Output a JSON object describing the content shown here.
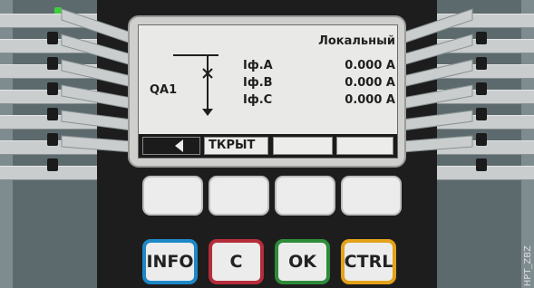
{
  "lcd": {
    "header": "Локальный",
    "device_label": "QA1",
    "measurements": [
      {
        "label": "Iф.A",
        "value": "0.000 A"
      },
      {
        "label": "Iф.B",
        "value": "0.000 A"
      },
      {
        "label": "Iф.C",
        "value": "0.000 A"
      }
    ],
    "softkeys": [
      {
        "icon": "arrow-left-icon",
        "label": ""
      },
      {
        "label": "ТКРЫТ"
      },
      {
        "label": ""
      },
      {
        "label": ""
      }
    ]
  },
  "buttons": {
    "blank_buttons": [
      "",
      "",
      "",
      ""
    ],
    "keys": [
      {
        "label": "INFO",
        "color": "#1e88c7"
      },
      {
        "label": "C",
        "color": "#b52d3a"
      },
      {
        "label": "OK",
        "color": "#2e8b3a"
      },
      {
        "label": "CTRL",
        "color": "#e3a21a"
      }
    ]
  },
  "indicator": {
    "color": "#3ccf3c"
  },
  "watermark": "HPT_ZBZ"
}
